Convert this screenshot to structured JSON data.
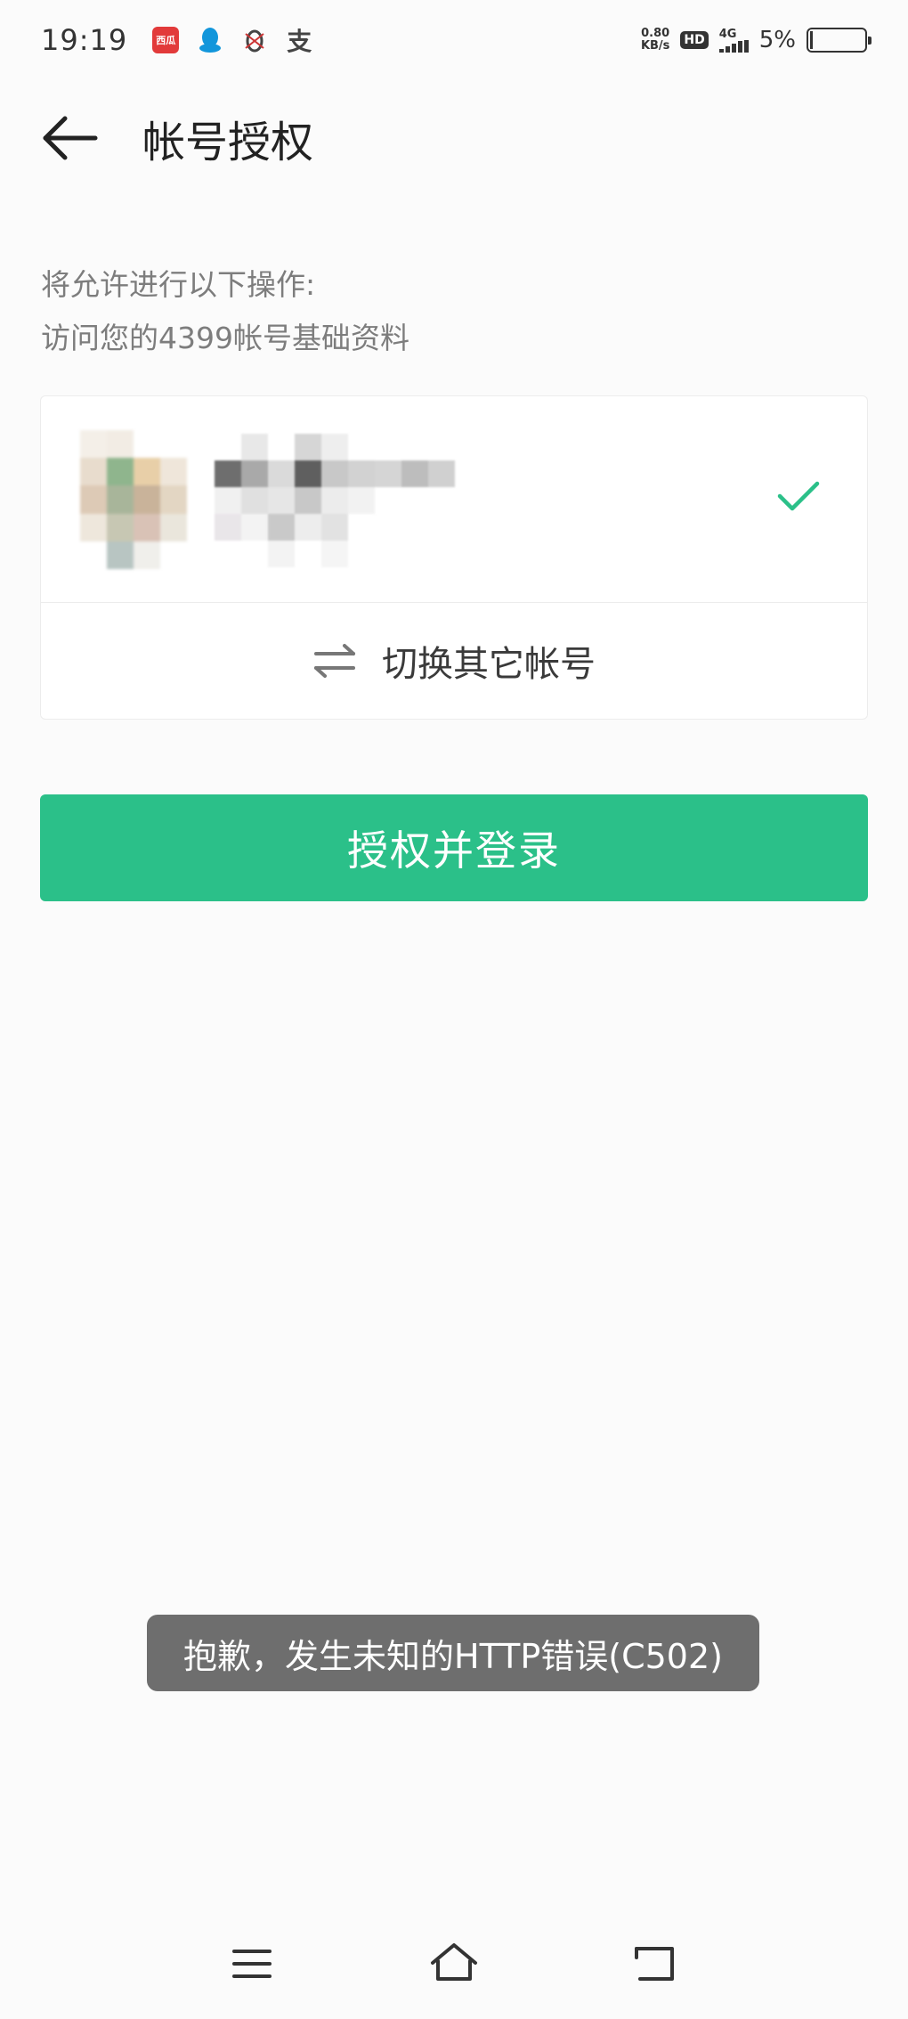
{
  "status_bar": {
    "time": "19:19",
    "notify_red_label": "西瓜",
    "notify_alipay_label": "支",
    "net_speed_value": "0.80",
    "net_speed_unit": "KB/s",
    "hd_label": "HD",
    "network_label": "4G",
    "battery_percent": "5%",
    "battery_level": 0.05
  },
  "header": {
    "title": "帐号授权"
  },
  "permissions": {
    "intro": "将允许进行以下操作:",
    "item": "访问您的4399帐号基础资料"
  },
  "account_card": {
    "switch_label": "切换其它帐号"
  },
  "auth_button": {
    "label": "授权并登录"
  },
  "toast": {
    "message": "抱歉，发生未知的HTTP错误(C502)"
  },
  "colors": {
    "accent": "#2bc089",
    "toast_bg": "#6e6e6e"
  },
  "icons": {
    "back": "arrow-left-icon",
    "check": "check-icon",
    "switch": "swap-arrows-icon",
    "nav_menu": "menu-icon",
    "nav_home": "home-icon",
    "nav_back": "return-icon"
  }
}
